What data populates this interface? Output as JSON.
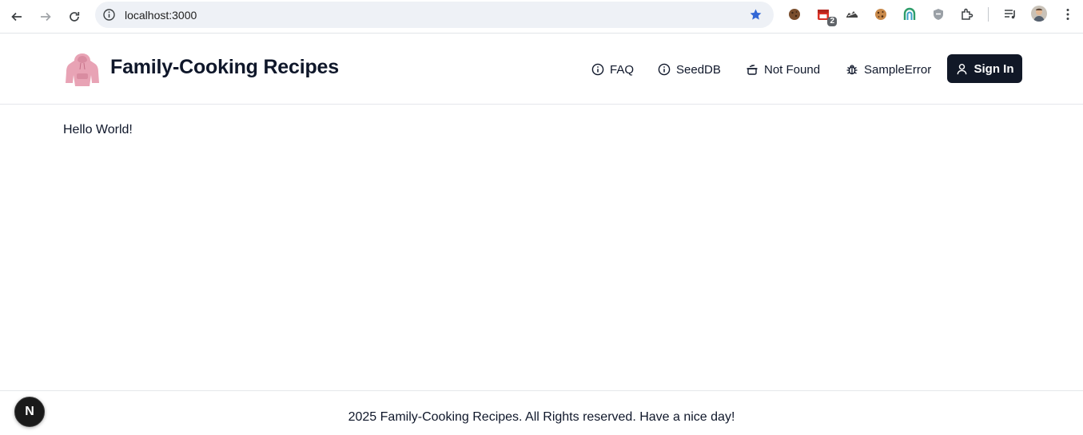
{
  "browser": {
    "url": "localhost:3000",
    "extension_badge": "2",
    "icons": [
      "back-icon",
      "forward-icon",
      "reload-icon",
      "site-info-icon",
      "bookmark-star-icon",
      "extensions-icon",
      "media-icon",
      "menu-icon"
    ]
  },
  "header": {
    "title": "Family-Cooking Recipes",
    "nav": [
      {
        "label": "FAQ",
        "icon": "info-icon"
      },
      {
        "label": "SeedDB",
        "icon": "info-icon"
      },
      {
        "label": "Not Found",
        "icon": "cooking-pot-icon"
      },
      {
        "label": "SampleError",
        "icon": "bug-icon"
      }
    ],
    "signin_label": "Sign In"
  },
  "main": {
    "text": "Hello World!"
  },
  "footer": {
    "text": "2025 Family-Cooking Recipes. All Rights reserved. Have a nice day!"
  },
  "dev_badge": "N",
  "colors": {
    "accent_dark": "#111827",
    "text": "#0f172a",
    "omnibox": "#eef1f6",
    "star": "#3367d6"
  }
}
